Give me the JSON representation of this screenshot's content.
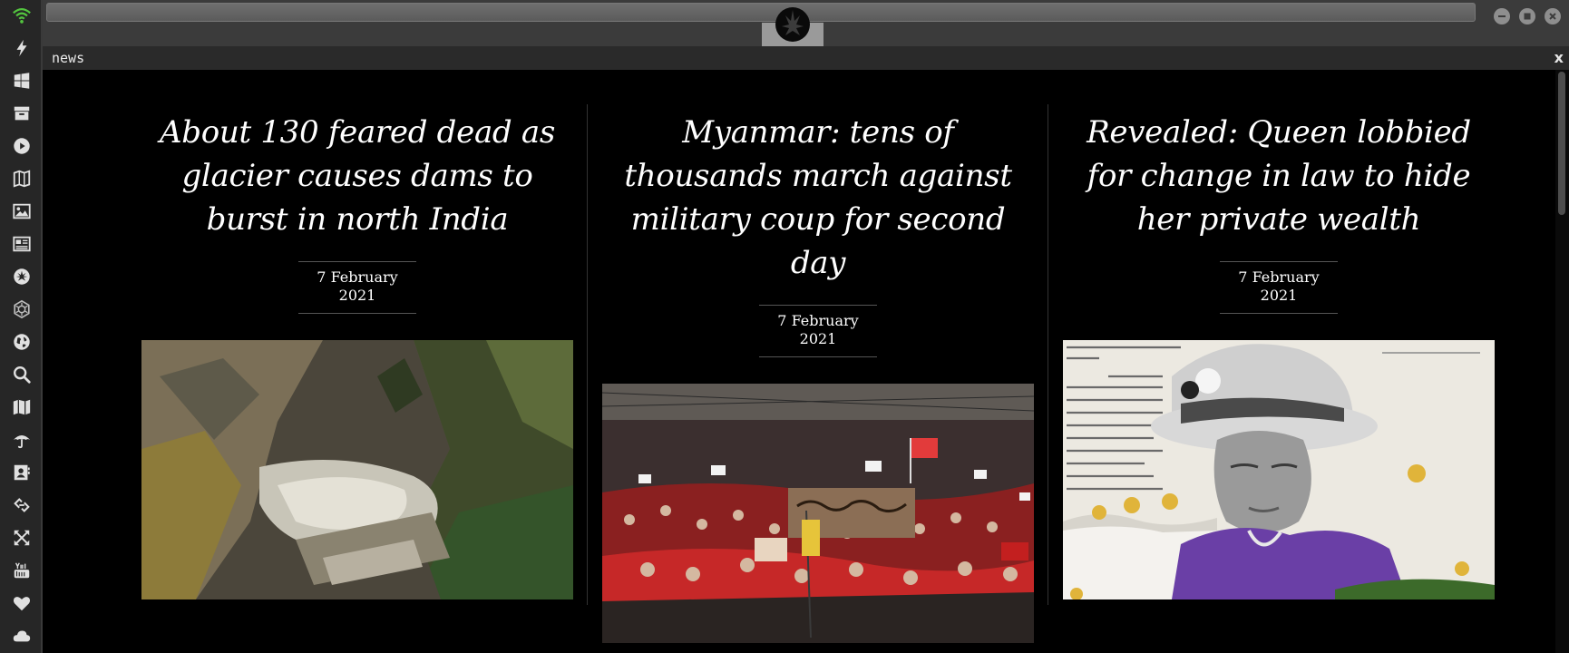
{
  "window": {
    "controls": [
      "minimize-icon",
      "maximize-icon",
      "close-icon"
    ],
    "logo": "rebel-alliance-logo"
  },
  "panel": {
    "title": "news",
    "close_label": "x"
  },
  "dock": {
    "icons": [
      "wifi-icon",
      "lightning-icon",
      "windows-icon",
      "archive-icon",
      "play-icon",
      "map-book-icon",
      "image-icon",
      "newspaper-icon",
      "rebel-icon",
      "empire-icon",
      "globe-icon",
      "search-icon",
      "map-icon",
      "umbrella-icon",
      "contacts-icon",
      "link-icon",
      "expand-icon",
      "youtube-icon",
      "heart-icon",
      "cloud-icon"
    ]
  },
  "articles": [
    {
      "headline": "About 130 feared dead as glacier causes dams to burst in north India",
      "date": "7 February 2021",
      "image": "glacier-valley-photo"
    },
    {
      "headline": "Myanmar: tens of thousands march against military coup for second day",
      "date": "7 February 2021",
      "image": "protest-crowd-photo"
    },
    {
      "headline": "Revealed: Queen lobbied for change in law to hide her private wealth",
      "date": "7 February 2021",
      "image": "queen-portrait-photo"
    }
  ],
  "colors": {
    "background": "#000000",
    "dock": "#262626",
    "titlebar": "#3b3b3b",
    "wifi_accent": "#53c43f",
    "protest_red": "#d42a2a",
    "queen_purple": "#6a3fa6"
  }
}
